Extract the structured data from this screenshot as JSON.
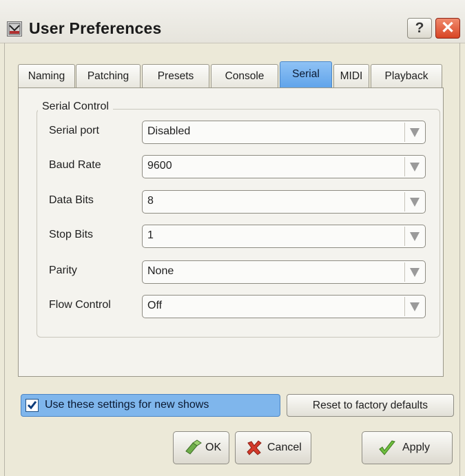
{
  "window": {
    "title": "User Preferences",
    "help_label": "?",
    "close_label": "✕"
  },
  "tabs": [
    {
      "label": "Naming",
      "active": false
    },
    {
      "label": "Patching",
      "active": false
    },
    {
      "label": "Presets",
      "active": false
    },
    {
      "label": "Console",
      "active": false
    },
    {
      "label": "Serial",
      "active": true
    },
    {
      "label": "MIDI",
      "active": false
    },
    {
      "label": "Playback",
      "active": false
    }
  ],
  "serial_control": {
    "group_label": "Serial Control",
    "fields": [
      {
        "label": "Serial port",
        "value": "Disabled"
      },
      {
        "label": "Baud Rate",
        "value": "9600"
      },
      {
        "label": "Data Bits",
        "value": "8"
      },
      {
        "label": "Stop Bits",
        "value": "1"
      },
      {
        "label": "Parity",
        "value": "None"
      },
      {
        "label": "Flow Control",
        "value": "Off"
      }
    ]
  },
  "footer": {
    "use_settings_label": "Use these settings for new shows",
    "use_settings_checked": true,
    "reset_label": "Reset to factory defaults",
    "ok_label": "OK",
    "cancel_label": "Cancel",
    "apply_label": "Apply"
  },
  "colors": {
    "active_tab": "#6aaaf0",
    "checkbox_highlight": "#7fb6ec",
    "close_button": "#d84424"
  }
}
